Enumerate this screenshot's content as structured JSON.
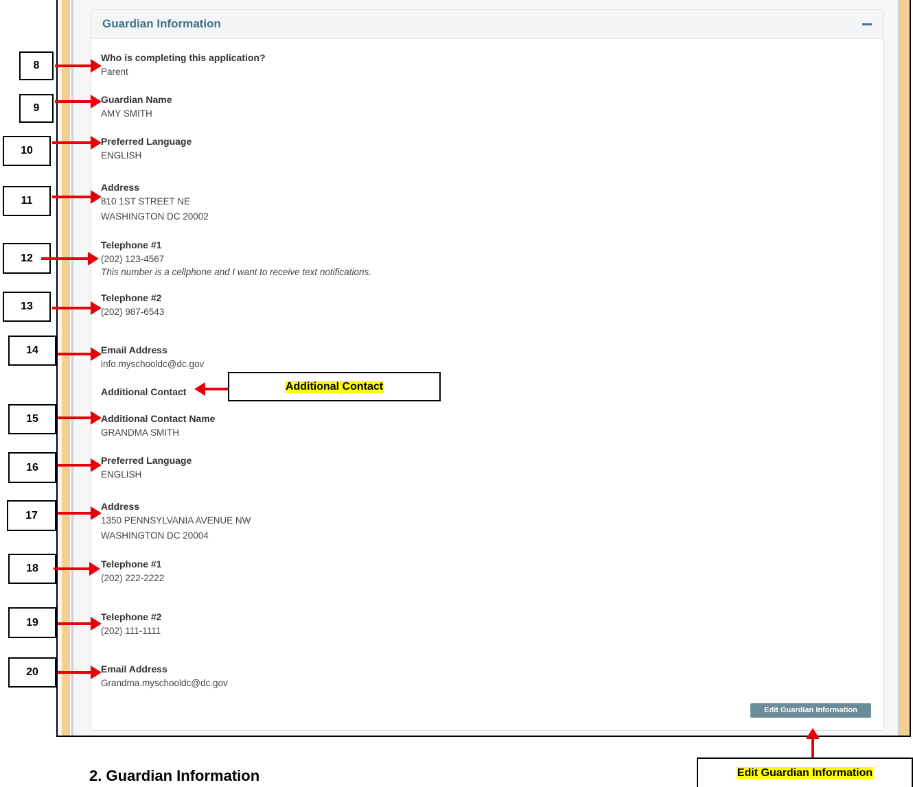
{
  "panel": {
    "title": "Guardian Information",
    "collapse_icon": "minus-icon"
  },
  "fields": [
    {
      "label": "Who is completing this application?",
      "values": [
        "Parent"
      ]
    },
    {
      "label": "Guardian Name",
      "values": [
        "AMY SMITH"
      ]
    },
    {
      "label": "Preferred Language",
      "values": [
        "ENGLISH"
      ]
    },
    {
      "label": "Address",
      "values": [
        "810 1ST STREET NE",
        "WASHINGTON DC 20002"
      ]
    },
    {
      "label": "Telephone #1",
      "values": [
        "(202) 123-4567"
      ],
      "note": "This number is a cellphone and I want to receive text notifications."
    },
    {
      "label": "Telephone #2",
      "values": [
        "(202) 987-6543"
      ]
    },
    {
      "label": "Email Address",
      "values": [
        "info.myschooldc@dc.gov"
      ]
    },
    {
      "label": "Additional Contact Name",
      "values": [
        "GRANDMA SMITH"
      ]
    },
    {
      "label": "Preferred Language",
      "values": [
        "ENGLISH"
      ]
    },
    {
      "label": "Address",
      "values": [
        "1350 PENNSYLVANIA AVENUE NW",
        "WASHINGTON DC 20004"
      ]
    },
    {
      "label": "Telephone #1",
      "values": [
        "(202) 222-2222"
      ]
    },
    {
      "label": "Telephone #2",
      "values": [
        "(202) 111-1111"
      ]
    },
    {
      "label": "Email Address",
      "values": [
        "Grandma.myschooldc@dc.gov"
      ]
    }
  ],
  "additional_contact_heading": "Additional Contact",
  "edit_button": "Edit Guardian Information",
  "callouts": {
    "numbers": [
      "8",
      "9",
      "10",
      "11",
      "12",
      "13",
      "14",
      "15",
      "16",
      "17",
      "18",
      "19",
      "20"
    ],
    "additional_contact": "Additional Contact",
    "edit_guardian": "Edit Guardian Information"
  },
  "section_heading": "2.   Guardian Information",
  "colors": {
    "panel_title": "#3f7489",
    "button": "#6b8c99",
    "arrow": "#e8000b",
    "highlight": "#ffff00",
    "stripe": "#f3d08f"
  }
}
